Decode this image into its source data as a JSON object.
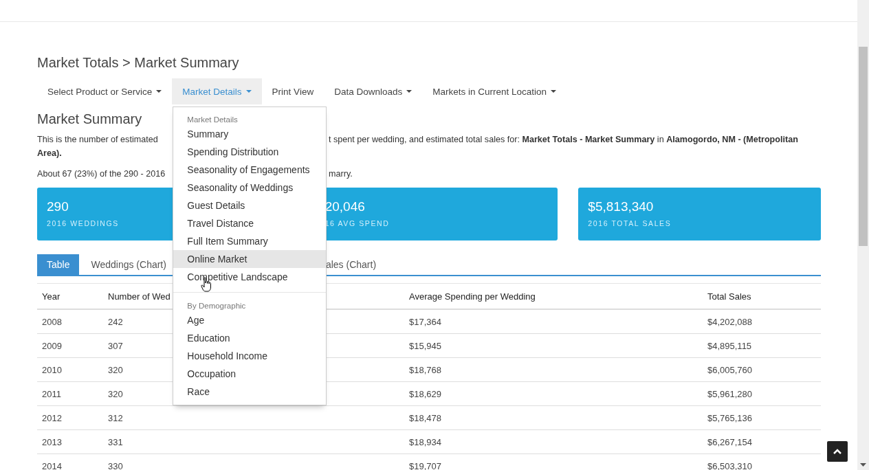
{
  "page_title": "Market Totals > Market Summary",
  "nav": [
    {
      "label": "Select Product or Service",
      "caret": true,
      "selected": false
    },
    {
      "label": "Market Details",
      "caret": true,
      "selected": true
    },
    {
      "label": "Print View",
      "caret": false,
      "selected": false
    },
    {
      "label": "Data Downloads",
      "caret": true,
      "selected": false
    },
    {
      "label": "Markets in Current Location",
      "caret": true,
      "selected": false
    }
  ],
  "dropdown": {
    "groups": [
      {
        "header": "Market Details",
        "items": [
          {
            "label": "Summary",
            "hovered": false
          },
          {
            "label": "Spending Distribution",
            "hovered": false
          },
          {
            "label": "Seasonality of Engagements",
            "hovered": false
          },
          {
            "label": "Seasonality of Weddings",
            "hovered": false
          },
          {
            "label": "Guest Details",
            "hovered": false
          },
          {
            "label": "Travel Distance",
            "hovered": false
          },
          {
            "label": "Full Item Summary",
            "hovered": false
          },
          {
            "label": "Online Market",
            "hovered": true
          },
          {
            "label": "Competitive Landscape",
            "hovered": false
          }
        ]
      },
      {
        "header": "By Demographic",
        "items": [
          {
            "label": "Age",
            "hovered": false
          },
          {
            "label": "Education",
            "hovered": false
          },
          {
            "label": "Household Income",
            "hovered": false
          },
          {
            "label": "Occupation",
            "hovered": false
          },
          {
            "label": "Race",
            "hovered": false
          }
        ]
      }
    ]
  },
  "section_title": "Market Summary",
  "description": {
    "line1_left": "This is the number of estimated",
    "line1_right": "t spent per wedding, and estimated total sales for: **Market Totals - Market Summary** in **Alamogordo, NM - (Metropolitan**",
    "line2": "Area).",
    "line3_left": "About 67 (23%) of the 290 - 2016",
    "line3_right": "marry."
  },
  "stats": [
    {
      "value": "290",
      "label": "2016 WEDDINGS"
    },
    {
      "value": "20,046",
      "label": "16 AVG SPEND"
    },
    {
      "value": "$5,813,340",
      "label": "2016 TOTAL SALES"
    }
  ],
  "tabs": [
    {
      "label": "Table",
      "selected": true
    },
    {
      "label": "Weddings (Chart)",
      "selected": false
    },
    {
      "label": "ales (Chart)",
      "selected": false
    }
  ],
  "table": {
    "columns": [
      "Year",
      "Number of Wed",
      "Average Spending per Wedding",
      "Total Sales"
    ],
    "rows": [
      [
        "2008",
        "242",
        "$17,364",
        "$4,202,088"
      ],
      [
        "2009",
        "307",
        "$15,945",
        "$4,895,115"
      ],
      [
        "2010",
        "320",
        "$18,768",
        "$6,005,760"
      ],
      [
        "2011",
        "320",
        "$18,629",
        "$5,961,280"
      ],
      [
        "2012",
        "312",
        "$18,478",
        "$5,765,136"
      ],
      [
        "2013",
        "331",
        "$18,934",
        "$6,267,154"
      ],
      [
        "2014",
        "330",
        "$19,707",
        "$6,503,310"
      ]
    ]
  }
}
